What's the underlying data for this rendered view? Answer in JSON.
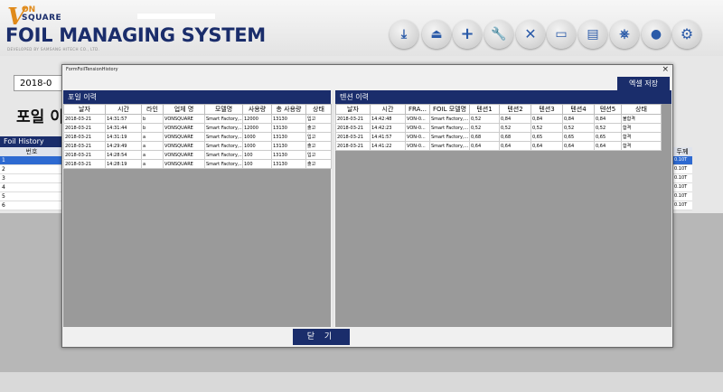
{
  "app": {
    "logo_v": "V",
    "logo_on": "ON",
    "logo_square": "SQUARE",
    "title": "FOIL MANAGING SYSTEM",
    "developed_by": "DEVELOPED BY SAMSANG HITECH CO., LTD."
  },
  "toolbar": [
    "download-icon",
    "upload-icon",
    "plus-icon",
    "wrench-icon",
    "close-icon",
    "laptop-icon",
    "book-icon",
    "network-icon",
    "user-icon",
    "gear-icon"
  ],
  "background": {
    "date": "2018-0",
    "title": "포일 이",
    "foil_history_header": "Foil History",
    "col_number": "번호",
    "rows": [
      "1",
      "2",
      "3",
      "4",
      "5",
      "6"
    ],
    "right_col_header": "두께",
    "right_col_values": [
      "0.10T",
      "0.10T",
      "0.10T",
      "0.10T",
      "0.10T",
      "0.10T"
    ]
  },
  "modal": {
    "window_title": "FormFoilTensionHistory",
    "close_x": "×",
    "excel_button": "엑셀 저장",
    "close_button": "닫 기",
    "foil": {
      "header": "포일 이력",
      "columns": [
        "날자",
        "시간",
        "라인",
        "업체 명",
        "모델명",
        "사용량",
        "총 사용량",
        "상태"
      ],
      "rows": [
        [
          "2018-03-21",
          "14:31:57",
          "b",
          "VONSQUARE",
          "Smart Factory,...",
          "12000",
          "13130",
          "입고"
        ],
        [
          "2018-03-21",
          "14:31:44",
          "b",
          "VONSQUARE",
          "Smart Factory,...",
          "12000",
          "13130",
          "출고"
        ],
        [
          "2018-03-21",
          "14:31:19",
          "a",
          "VONSQUARE",
          "Smart Factory,...",
          "1000",
          "13130",
          "입고"
        ],
        [
          "2018-03-21",
          "14:29:49",
          "a",
          "VONSQUARE",
          "Smart Factory,...",
          "1000",
          "13130",
          "출고"
        ],
        [
          "2018-03-21",
          "14:28:54",
          "a",
          "VONSQUARE",
          "Smart Factory,...",
          "100",
          "13130",
          "입고"
        ],
        [
          "2018-03-21",
          "14:28:19",
          "a",
          "VONSQUARE",
          "Smart Factory,...",
          "100",
          "13130",
          "출고"
        ]
      ]
    },
    "tension": {
      "header": "텐션 이력",
      "columns": [
        "날자",
        "시간",
        "FRA...",
        "FOIL 모델명",
        "텐션1",
        "텐션2",
        "텐션3",
        "텐션4",
        "텐션5",
        "상태"
      ],
      "rows": [
        [
          "2018-03-21",
          "14:42:48",
          "VON-0...",
          "Smart Factory,...",
          "0,52",
          "0,84",
          "0,84",
          "0,84",
          "0,84",
          "불합격"
        ],
        [
          "2018-03-21",
          "14:42:23",
          "VON-0...",
          "Smart Factory,...",
          "0,52",
          "0,52",
          "0,52",
          "0,52",
          "0,52",
          "합격"
        ],
        [
          "2018-03-21",
          "14:41:57",
          "VON-0...",
          "Smart Factory,...",
          "0,68",
          "0,68",
          "0,65",
          "0,65",
          "0,65",
          "합격"
        ],
        [
          "2018-03-21",
          "14:41:22",
          "VON-0...",
          "Smart Factory,...",
          "0,64",
          "0,64",
          "0,64",
          "0,64",
          "0,64",
          "합격"
        ]
      ]
    }
  }
}
